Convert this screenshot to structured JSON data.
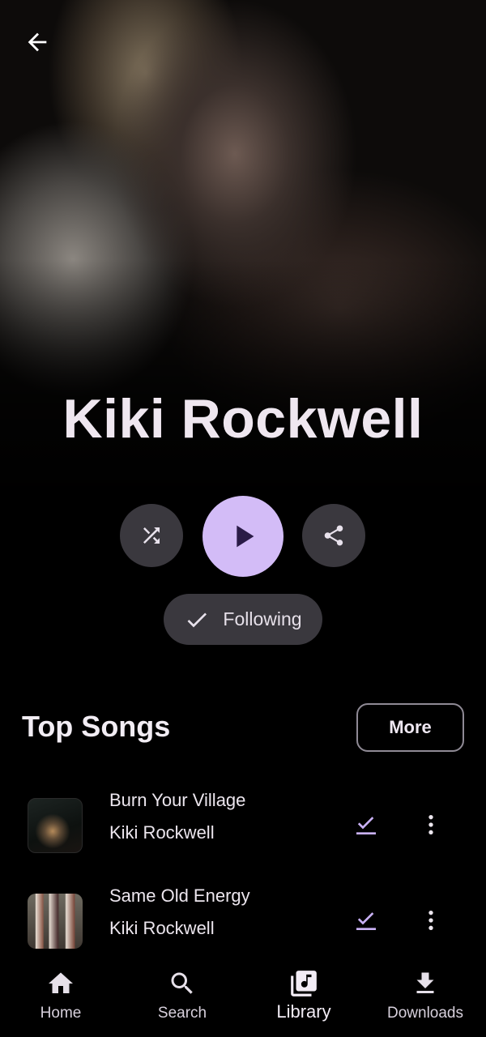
{
  "artist": {
    "name": "Kiki Rockwell"
  },
  "actions": {
    "back_icon": "arrow-back-icon",
    "shuffle_icon": "shuffle-icon",
    "play_icon": "play-icon",
    "share_icon": "share-icon",
    "follow_label": "Following",
    "follow_icon": "check-icon"
  },
  "top_songs": {
    "title": "Top Songs",
    "more_label": "More",
    "songs": [
      {
        "title": "Burn Your Village",
        "artist": "Kiki Rockwell",
        "downloaded": true
      },
      {
        "title": "Same Old Energy",
        "artist": "Kiki Rockwell",
        "downloaded": true
      }
    ]
  },
  "nav": {
    "items": [
      {
        "label": "Home",
        "icon": "home-icon",
        "active": false
      },
      {
        "label": "Search",
        "icon": "search-icon",
        "active": false
      },
      {
        "label": "Library",
        "icon": "library-music-icon",
        "active": true
      },
      {
        "label": "Downloads",
        "icon": "download-icon",
        "active": false
      }
    ]
  },
  "colors": {
    "accent": "#d3bcf7",
    "button_bg": "#3a383e",
    "background": "#000000"
  }
}
